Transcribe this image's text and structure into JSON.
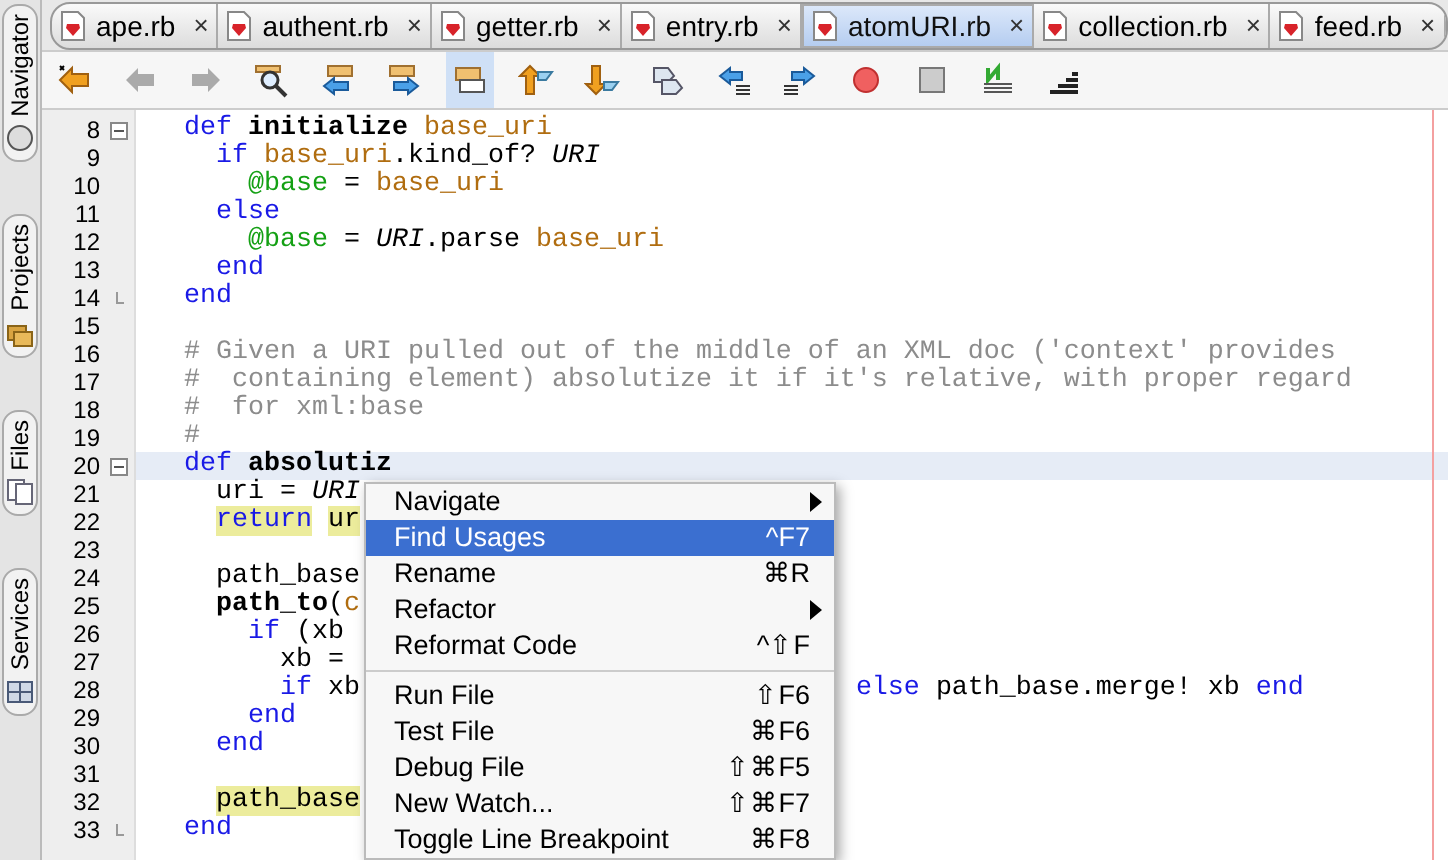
{
  "side_tabs": [
    {
      "label": "Navigator"
    },
    {
      "label": "Projects"
    },
    {
      "label": "Files"
    },
    {
      "label": "Services"
    }
  ],
  "file_tabs": [
    {
      "label": "ape.rb",
      "close": "×",
      "selected": false
    },
    {
      "label": "authent.rb",
      "close": "×",
      "selected": false
    },
    {
      "label": "getter.rb",
      "close": "×",
      "selected": false
    },
    {
      "label": "entry.rb",
      "close": "×",
      "selected": false
    },
    {
      "label": "atomURI.rb",
      "close": "×",
      "selected": true
    },
    {
      "label": "collection.rb",
      "close": "×",
      "selected": false
    },
    {
      "label": "feed.rb",
      "close": "×",
      "selected": false
    }
  ],
  "toolbar": [
    {
      "kind": "back-star",
      "selected": false
    },
    {
      "kind": "back",
      "selected": false
    },
    {
      "kind": "forward",
      "selected": false
    },
    {
      "kind": "search",
      "selected": false
    },
    {
      "kind": "prev-occ",
      "selected": false
    },
    {
      "kind": "next-occ",
      "selected": false
    },
    {
      "kind": "toggle-highlight",
      "selected": true
    },
    {
      "kind": "up",
      "selected": false
    },
    {
      "kind": "down",
      "selected": false
    },
    {
      "kind": "bookmark",
      "selected": false
    },
    {
      "kind": "shift-left",
      "selected": false
    },
    {
      "kind": "shift-right",
      "selected": false
    },
    {
      "kind": "record",
      "selected": false
    },
    {
      "kind": "stop",
      "selected": false
    },
    {
      "kind": "playback",
      "selected": false
    },
    {
      "kind": "stairs",
      "selected": false
    }
  ],
  "code_lines": [
    {
      "number": "8",
      "fold_open": true,
      "tokens": [
        {
          "t": "  def",
          "kind": "keyword"
        },
        {
          "t": " initialize",
          "kind": "bold"
        },
        {
          "t": " base_uri",
          "kind": "variable"
        }
      ]
    },
    {
      "number": "9",
      "tokens": [
        {
          "t": "    if",
          "kind": "keyword"
        },
        {
          "t": " base_uri",
          "kind": "variable"
        },
        {
          "t": ".kind_of? ",
          "kind": "plain"
        },
        {
          "t": "URI",
          "kind": "constant"
        }
      ]
    },
    {
      "number": "10",
      "tokens": [
        {
          "t": "      @base",
          "kind": "ivar"
        },
        {
          "t": " = ",
          "kind": "plain"
        },
        {
          "t": "base_uri",
          "kind": "variable"
        }
      ]
    },
    {
      "number": "11",
      "tokens": [
        {
          "t": "    else",
          "kind": "keyword"
        }
      ]
    },
    {
      "number": "12",
      "tokens": [
        {
          "t": "      @base",
          "kind": "ivar"
        },
        {
          "t": " = ",
          "kind": "plain"
        },
        {
          "t": "URI",
          "kind": "constant"
        },
        {
          "t": ".parse ",
          "kind": "plain"
        },
        {
          "t": "base_uri",
          "kind": "variable"
        }
      ]
    },
    {
      "number": "13",
      "tokens": [
        {
          "t": "    end",
          "kind": "keyword"
        }
      ]
    },
    {
      "number": "14",
      "fold_close": true,
      "tokens": [
        {
          "t": "  end",
          "kind": "keyword"
        }
      ]
    },
    {
      "number": "15"
    },
    {
      "number": "16",
      "tokens": [
        {
          "t": "  # Given a URI pulled out of the middle of an XML doc ('context' provides",
          "kind": "comment"
        }
      ]
    },
    {
      "number": "17",
      "tokens": [
        {
          "t": "  #  containing element) absolutize it if it's relative, with proper regard",
          "kind": "comment"
        }
      ]
    },
    {
      "number": "18",
      "tokens": [
        {
          "t": "  #  for xml:base",
          "kind": "comment"
        }
      ]
    },
    {
      "number": "19",
      "tokens": [
        {
          "t": "  #",
          "kind": "comment"
        }
      ]
    },
    {
      "number": "20",
      "fold_open": true,
      "current": true,
      "tokens": [
        {
          "t": "  def",
          "kind": "keyword"
        },
        {
          "t": " absolutiz",
          "kind": "bold"
        }
      ]
    },
    {
      "number": "21",
      "tokens": [
        {
          "t": "    uri = ",
          "kind": "plain"
        },
        {
          "t": "URI",
          "kind": "constant"
        }
      ]
    },
    {
      "number": "22",
      "tokens": [
        {
          "t": "    return",
          "kind": "keyword",
          "highlighted": true
        },
        {
          "t": " ur",
          "kind": "plain",
          "highlighted": true
        }
      ]
    },
    {
      "number": "23"
    },
    {
      "number": "24",
      "tokens": [
        {
          "t": "    path_base",
          "kind": "plain"
        }
      ]
    },
    {
      "number": "25",
      "tokens": [
        {
          "t": "    path_to",
          "kind": "bold"
        },
        {
          "t": "(",
          "kind": "plain"
        },
        {
          "t": "c",
          "kind": "variable"
        }
      ]
    },
    {
      "number": "26",
      "tokens": [
        {
          "t": "      if",
          "kind": "keyword"
        },
        {
          "t": " (xb",
          "kind": "plain"
        }
      ]
    },
    {
      "number": "27",
      "tokens": [
        {
          "t": "        xb =",
          "kind": "plain"
        }
      ]
    },
    {
      "number": "28",
      "tokens": [
        {
          "t": "        if",
          "kind": "keyword"
        },
        {
          "t": " xb",
          "kind": "plain"
        }
      ],
      "after": [
        {
          "t": "else",
          "kind": "keyword"
        },
        {
          "t": " path_base.merge! xb ",
          "kind": "plain"
        },
        {
          "t": "end",
          "kind": "keyword"
        }
      ]
    },
    {
      "number": "29",
      "tokens": [
        {
          "t": "      end",
          "kind": "keyword"
        }
      ]
    },
    {
      "number": "30",
      "tokens": [
        {
          "t": "    end",
          "kind": "keyword"
        }
      ]
    },
    {
      "number": "31"
    },
    {
      "number": "32",
      "tokens": [
        {
          "t": "    path_base",
          "kind": "plain",
          "highlighted": true
        }
      ]
    },
    {
      "number": "33",
      "fold_close": true,
      "tokens": [
        {
          "t": "  end",
          "kind": "keyword"
        }
      ]
    }
  ],
  "context_menu": [
    {
      "label": "Navigate",
      "submenu": true,
      "selected": false
    },
    {
      "label": "Find Usages",
      "shortcut": "^F7",
      "selected": true
    },
    {
      "label": "Rename",
      "shortcut": "⌘R",
      "selected": false
    },
    {
      "label": "Refactor",
      "submenu": true,
      "selected": false
    },
    {
      "label": "Reformat Code",
      "shortcut": "^⇧F",
      "selected": false
    },
    {
      "kind": "separator"
    },
    {
      "label": "Run File",
      "shortcut": "⇧F6",
      "selected": false
    },
    {
      "label": "Test File",
      "shortcut": "⌘F6",
      "selected": false
    },
    {
      "label": "Debug File",
      "shortcut": "⇧⌘F5",
      "selected": false
    },
    {
      "label": "New Watch...",
      "shortcut": "⇧⌘F7",
      "selected": false
    },
    {
      "label": "Toggle Line Breakpoint",
      "shortcut": "⌘F8",
      "selected": false
    }
  ]
}
